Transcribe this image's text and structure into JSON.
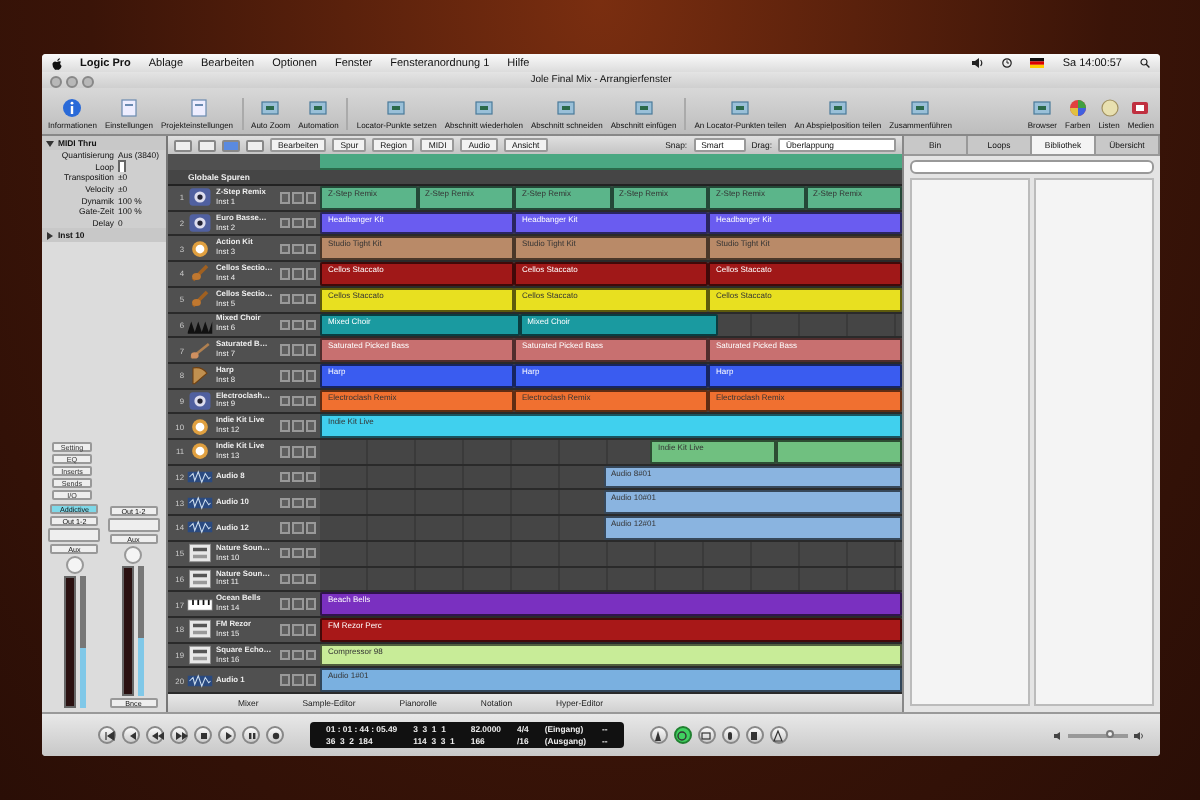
{
  "menubar": {
    "app": "Logic Pro",
    "items": [
      "Ablage",
      "Bearbeiten",
      "Optionen",
      "Fenster",
      "Fensteranordnung 1",
      "Hilfe"
    ],
    "clock": "Sa 14:00:57"
  },
  "window": {
    "title": "Jole Final Mix - Arrangierfenster"
  },
  "toolbar": {
    "left": [
      {
        "label": "Informationen"
      },
      {
        "label": "Einstellungen"
      },
      {
        "label": "Projekteinstellungen"
      },
      {
        "label": "Auto Zoom"
      },
      {
        "label": "Automation"
      },
      {
        "label": "Locator-Punkte setzen"
      },
      {
        "label": "Abschnitt wiederholen"
      },
      {
        "label": "Abschnitt schneiden"
      },
      {
        "label": "Abschnitt einfügen"
      },
      {
        "label": "An Locator-Punkten teilen"
      },
      {
        "label": "An Abspielposition teilen"
      },
      {
        "label": "Zusammenführen"
      }
    ],
    "right": [
      {
        "label": "Browser"
      },
      {
        "label": "Farben"
      },
      {
        "label": "Listen"
      },
      {
        "label": "Medien"
      }
    ]
  },
  "local_menu": {
    "items": [
      "Bearbeiten",
      "Spur",
      "Region",
      "MIDI",
      "Audio",
      "Ansicht"
    ],
    "snap_label": "Snap:",
    "snap": "Smart",
    "drag_label": "Drag:",
    "drag": "Überlappung"
  },
  "inspector": {
    "section": "MIDI Thru",
    "params": [
      {
        "label": "Quantisierung",
        "value": "Aus (3840)"
      },
      {
        "label": "Loop",
        "kind": "checkbox",
        "checked": false
      },
      {
        "label": "Transposition",
        "value": "±0"
      },
      {
        "label": "Velocity",
        "value": "±0"
      },
      {
        "label": "Dynamik",
        "value": "100 %"
      },
      {
        "label": "Gate-Zeit",
        "value": "100 %"
      },
      {
        "label": "Delay",
        "value": "0"
      }
    ],
    "track_section": "Inst 10",
    "slots": [
      "Setting",
      "EQ",
      "Inserts",
      "Sends",
      "I/O"
    ],
    "strips": [
      {
        "input": "Addictive",
        "output": "Out 1-2",
        "send": "Aux",
        "level": 0.45
      },
      {
        "output": "Out 1-2",
        "send": "Aux",
        "level": 0.45,
        "footer": "Bnce"
      }
    ]
  },
  "global_tracks": "Globale Spuren",
  "tracks": [
    {
      "number": "1",
      "name": "Z-Step Remix",
      "sub": "Inst 1",
      "color": "#5bb58a",
      "regions": [
        {
          "kind": "region",
          "name": "Z-Step Remix"
        },
        {
          "kind": "region",
          "name": "Z-Step Remix"
        },
        {
          "kind": "region",
          "name": "Z-Step Remix"
        },
        {
          "kind": "region",
          "name": "Z-Step Remix"
        },
        {
          "kind": "region",
          "name": "Z-Step Remix"
        },
        {
          "kind": "region",
          "name": "Z-Step Remix"
        }
      ]
    },
    {
      "number": "2",
      "name": "Euro Basse…",
      "sub": "Inst 2",
      "color": "#6a5cf0",
      "regions": [
        {
          "kind": "region",
          "name": "Headbanger Kit"
        },
        {
          "kind": "region",
          "name": "Headbanger Kit"
        },
        {
          "kind": "region",
          "name": "Headbanger Kit"
        }
      ]
    },
    {
      "number": "3",
      "name": "Action Kit",
      "sub": "Inst 3",
      "color": "#b98a68",
      "regions": [
        {
          "kind": "region",
          "name": "Studio Tight Kit"
        },
        {
          "kind": "region",
          "name": "Studio Tight Kit"
        },
        {
          "kind": "region",
          "name": "Studio Tight Kit"
        }
      ]
    },
    {
      "number": "4",
      "name": "Cellos Sectio…",
      "sub": "Inst 4",
      "color": "#a01818",
      "regions": [
        {
          "kind": "region",
          "name": "Cellos Staccato"
        },
        {
          "kind": "region",
          "name": "Cellos Staccato"
        },
        {
          "kind": "region",
          "name": "Cellos Staccato"
        }
      ]
    },
    {
      "number": "5",
      "name": "Cellos Sectio…",
      "sub": "Inst 5",
      "color": "#e8e020",
      "regions": [
        {
          "kind": "region",
          "name": "Cellos Staccato"
        },
        {
          "kind": "region",
          "name": "Cellos Staccato"
        },
        {
          "kind": "region",
          "name": "Cellos Staccato"
        }
      ]
    },
    {
      "number": "6",
      "name": "Mixed Choir",
      "sub": "Inst 6",
      "color": "#1a9aa0",
      "regions": [
        {
          "kind": "region",
          "name": "Mixed Choir"
        },
        {
          "kind": "region",
          "name": "Mixed Choir"
        },
        {
          "kind": "gap"
        }
      ]
    },
    {
      "number": "7",
      "name": "Saturated B…",
      "sub": "Inst 7",
      "color": "#c87070",
      "regions": [
        {
          "kind": "region",
          "name": "Saturated Picked Bass"
        },
        {
          "kind": "region",
          "name": "Saturated Picked Bass"
        },
        {
          "kind": "region",
          "name": "Saturated Picked Bass"
        }
      ]
    },
    {
      "number": "8",
      "name": "Harp",
      "sub": "Inst 8",
      "color": "#3a5cf0",
      "regions": [
        {
          "kind": "region",
          "name": "Harp"
        },
        {
          "kind": "region",
          "name": "Harp"
        },
        {
          "kind": "region",
          "name": "Harp"
        }
      ]
    },
    {
      "number": "9",
      "name": "Electroclash…",
      "sub": "Inst 9",
      "color": "#f07030",
      "regions": [
        {
          "kind": "region",
          "name": "Electroclash Remix"
        },
        {
          "kind": "region",
          "name": "Electroclash Remix"
        },
        {
          "kind": "region",
          "name": "Electroclash Remix"
        }
      ]
    },
    {
      "number": "10",
      "name": "Indie Kit Live",
      "sub": "Inst 12",
      "color": "#40d0ee",
      "regions": [
        {
          "kind": "region",
          "name": "Indie Kit Live"
        }
      ]
    },
    {
      "number": "11",
      "name": "Indie Kit Live",
      "sub": "Inst 13",
      "color": "#70c080",
      "regions": [
        {
          "kind": "gap"
        },
        {
          "kind": "gap"
        },
        {
          "kind": "gap"
        },
        {
          "kind": "region",
          "name": "Indie Kit Live"
        },
        {
          "kind": "region"
        }
      ]
    },
    {
      "number": "12",
      "name": "Audio 8",
      "color": "#8ab4e0",
      "regions": [
        {
          "kind": "gap"
        },
        {
          "kind": "region",
          "name": "Audio 8#01"
        }
      ]
    },
    {
      "number": "13",
      "name": "Audio 10",
      "color": "#8ab4e0",
      "regions": [
        {
          "kind": "gap"
        },
        {
          "kind": "region",
          "name": "Audio 10#01"
        }
      ]
    },
    {
      "number": "14",
      "name": "Audio 12",
      "color": "#8ab4e0",
      "regions": [
        {
          "kind": "gap"
        },
        {
          "kind": "region",
          "name": "Audio 12#01"
        }
      ]
    },
    {
      "number": "15",
      "name": "Nature Soun…",
      "sub": "Inst 10"
    },
    {
      "number": "16",
      "name": "Nature Soun…",
      "sub": "Inst 11"
    },
    {
      "number": "17",
      "name": "Ocean Bells",
      "sub": "Inst 14",
      "color": "#7a30c0",
      "regions": [
        {
          "kind": "region",
          "name": "Beach Bells"
        }
      ]
    },
    {
      "number": "18",
      "name": "FM Rezor",
      "sub": "Inst 15",
      "color": "#a81818",
      "regions": [
        {
          "kind": "region",
          "name": "FM Rezor Perc"
        }
      ]
    },
    {
      "number": "19",
      "name": "Square Echo…",
      "sub": "Inst 16",
      "color": "#c8ec98",
      "regions": [
        {
          "kind": "region",
          "name": "Compressor 98"
        }
      ]
    },
    {
      "number": "20",
      "name": "Audio 1",
      "color": "#7ab0e0",
      "regions": [
        {
          "kind": "region",
          "name": "Audio 1#01"
        }
      ]
    }
  ],
  "editor_tabs": [
    "Mixer",
    "Sample-Editor",
    "Pianorolle",
    "Notation",
    "Hyper-Editor"
  ],
  "media": {
    "tabs": [
      {
        "label": "Bin",
        "selected": false
      },
      {
        "label": "Loops",
        "selected": false
      },
      {
        "label": "Bibliothek",
        "selected": true
      },
      {
        "label": "Übersicht",
        "selected": false
      }
    ]
  },
  "transport": {
    "buttons": [
      {
        "kind": "start",
        "selected": false
      },
      {
        "kind": "back",
        "selected": false
      },
      {
        "kind": "rewind",
        "selected": false
      },
      {
        "kind": "forward",
        "selected": false
      },
      {
        "kind": "stop",
        "selected": false
      },
      {
        "kind": "play",
        "selected": false
      },
      {
        "kind": "pause",
        "selected": false
      },
      {
        "kind": "record",
        "selected": false
      }
    ],
    "display": [
      [
        "01 : 01 : 44 : 05.49",
        "3  3  1  1",
        "82.0000",
        "4/4",
        "(Eingang)",
        "--"
      ],
      [
        "36  3  2  184",
        "114  3  3  1",
        "166",
        "/16",
        "(Ausgang)",
        "--"
      ]
    ],
    "modes": [
      {
        "kind": "metronome",
        "selected": false
      },
      {
        "kind": "cycle",
        "selected": true
      },
      {
        "kind": "replace",
        "selected": false
      },
      {
        "kind": "solo",
        "selected": false
      },
      {
        "kind": "sync",
        "selected": false
      },
      {
        "kind": "tuner",
        "selected": false
      }
    ],
    "volume": {
      "level": 0.7
    }
  }
}
